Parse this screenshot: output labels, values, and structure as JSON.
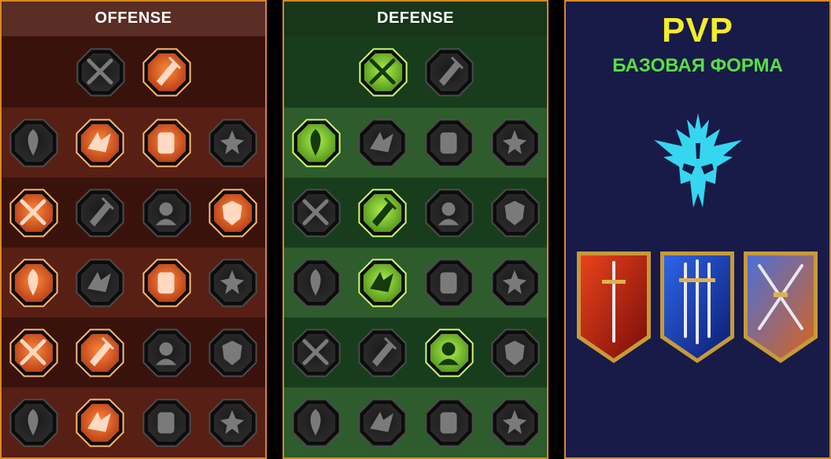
{
  "offense": {
    "title": "OFFENSE",
    "rows": [
      [
        {
          "icon": "crossed-swords-icon",
          "active": false
        },
        {
          "icon": "dagger-strike-icon",
          "active": true
        }
      ],
      [
        {
          "icon": "horned-figure-icon",
          "active": false
        },
        {
          "icon": "claw-slash-icon",
          "active": true
        },
        {
          "icon": "fist-shield-icon",
          "active": true
        },
        {
          "icon": "bleeding-heart-icon",
          "active": false
        }
      ],
      [
        {
          "icon": "archer-arrows-icon",
          "active": true
        },
        {
          "icon": "fanged-mouth-icon",
          "active": false
        },
        {
          "icon": "skull-cloak-icon",
          "active": false
        },
        {
          "icon": "hand-blade-icon",
          "active": true
        }
      ],
      [
        {
          "icon": "sword-drop-icon",
          "active": true
        },
        {
          "icon": "fist-hammer-icon",
          "active": false
        },
        {
          "icon": "axe-strike-icon",
          "active": true
        },
        {
          "icon": "chain-lightning-icon",
          "active": false
        }
      ],
      [
        {
          "icon": "burst-target-icon",
          "active": true
        },
        {
          "icon": "triple-skull-icon",
          "active": true
        },
        {
          "icon": "dagger-ring-icon",
          "active": false
        },
        {
          "icon": "warrior-burst-icon",
          "active": false
        }
      ],
      [
        {
          "icon": "sword-sparkle-icon",
          "active": false
        },
        {
          "icon": "flaming-helm-icon",
          "active": true
        },
        {
          "icon": "giant-brute-icon",
          "active": false
        },
        {
          "icon": "skull-helm-icon",
          "active": false
        }
      ]
    ]
  },
  "defense": {
    "title": "DEFENSE",
    "rows": [
      [
        {
          "icon": "armor-scales-icon",
          "active": true
        },
        {
          "icon": "raised-fist-icon",
          "active": false
        }
      ],
      [
        {
          "icon": "chevron-shield-icon",
          "active": true
        },
        {
          "icon": "heart-hand-icon",
          "active": false
        },
        {
          "icon": "stone-golem-icon",
          "active": false
        },
        {
          "icon": "crossed-blades-icon",
          "active": false
        }
      ],
      [
        {
          "icon": "fighter-stance-icon",
          "active": false
        },
        {
          "icon": "knight-shield-icon",
          "active": true
        },
        {
          "icon": "heart-shield-icon",
          "active": false
        },
        {
          "icon": "hooded-figure-icon",
          "active": false
        }
      ],
      [
        {
          "icon": "crowd-icon",
          "active": false
        },
        {
          "icon": "hourglass-icon",
          "active": true
        },
        {
          "icon": "open-hand-icon",
          "active": false
        },
        {
          "icon": "bull-head-icon",
          "active": false
        }
      ],
      [
        {
          "icon": "dash-runner-icon",
          "active": false
        },
        {
          "icon": "triple-drop-icon",
          "active": false
        },
        {
          "icon": "radiant-skull-icon",
          "active": true
        },
        {
          "icon": "swirl-arrow-icon",
          "active": false
        }
      ],
      [
        {
          "icon": "spiked-warrior-icon",
          "active": false
        },
        {
          "icon": "winged-shield-icon",
          "active": false
        },
        {
          "icon": "bearded-face-icon",
          "active": false
        },
        {
          "icon": "strongman-icon",
          "active": false
        }
      ]
    ]
  },
  "pvp": {
    "title": "PVP",
    "subtitle": "БАЗОВАЯ ФОРМА",
    "emblem_icon": "demon-helm-icon",
    "banners": [
      {
        "icon": "red-knight-sword-banner-icon",
        "colors": [
          "#e8431c",
          "#7a0d08"
        ]
      },
      {
        "icon": "blue-triple-sword-banner-icon",
        "colors": [
          "#2d65e8",
          "#0c1c70"
        ]
      },
      {
        "icon": "crossed-swords-dual-banner-icon",
        "colors": [
          "#4a6fd8",
          "#d8641e"
        ]
      }
    ]
  },
  "colors": {
    "border": "#d9891e",
    "offense_active": "#e8631e",
    "defense_active": "#7ed321",
    "pvp_title": "#f2ee27",
    "pvp_subtitle": "#57e044",
    "emblem": "#36d6f0"
  }
}
